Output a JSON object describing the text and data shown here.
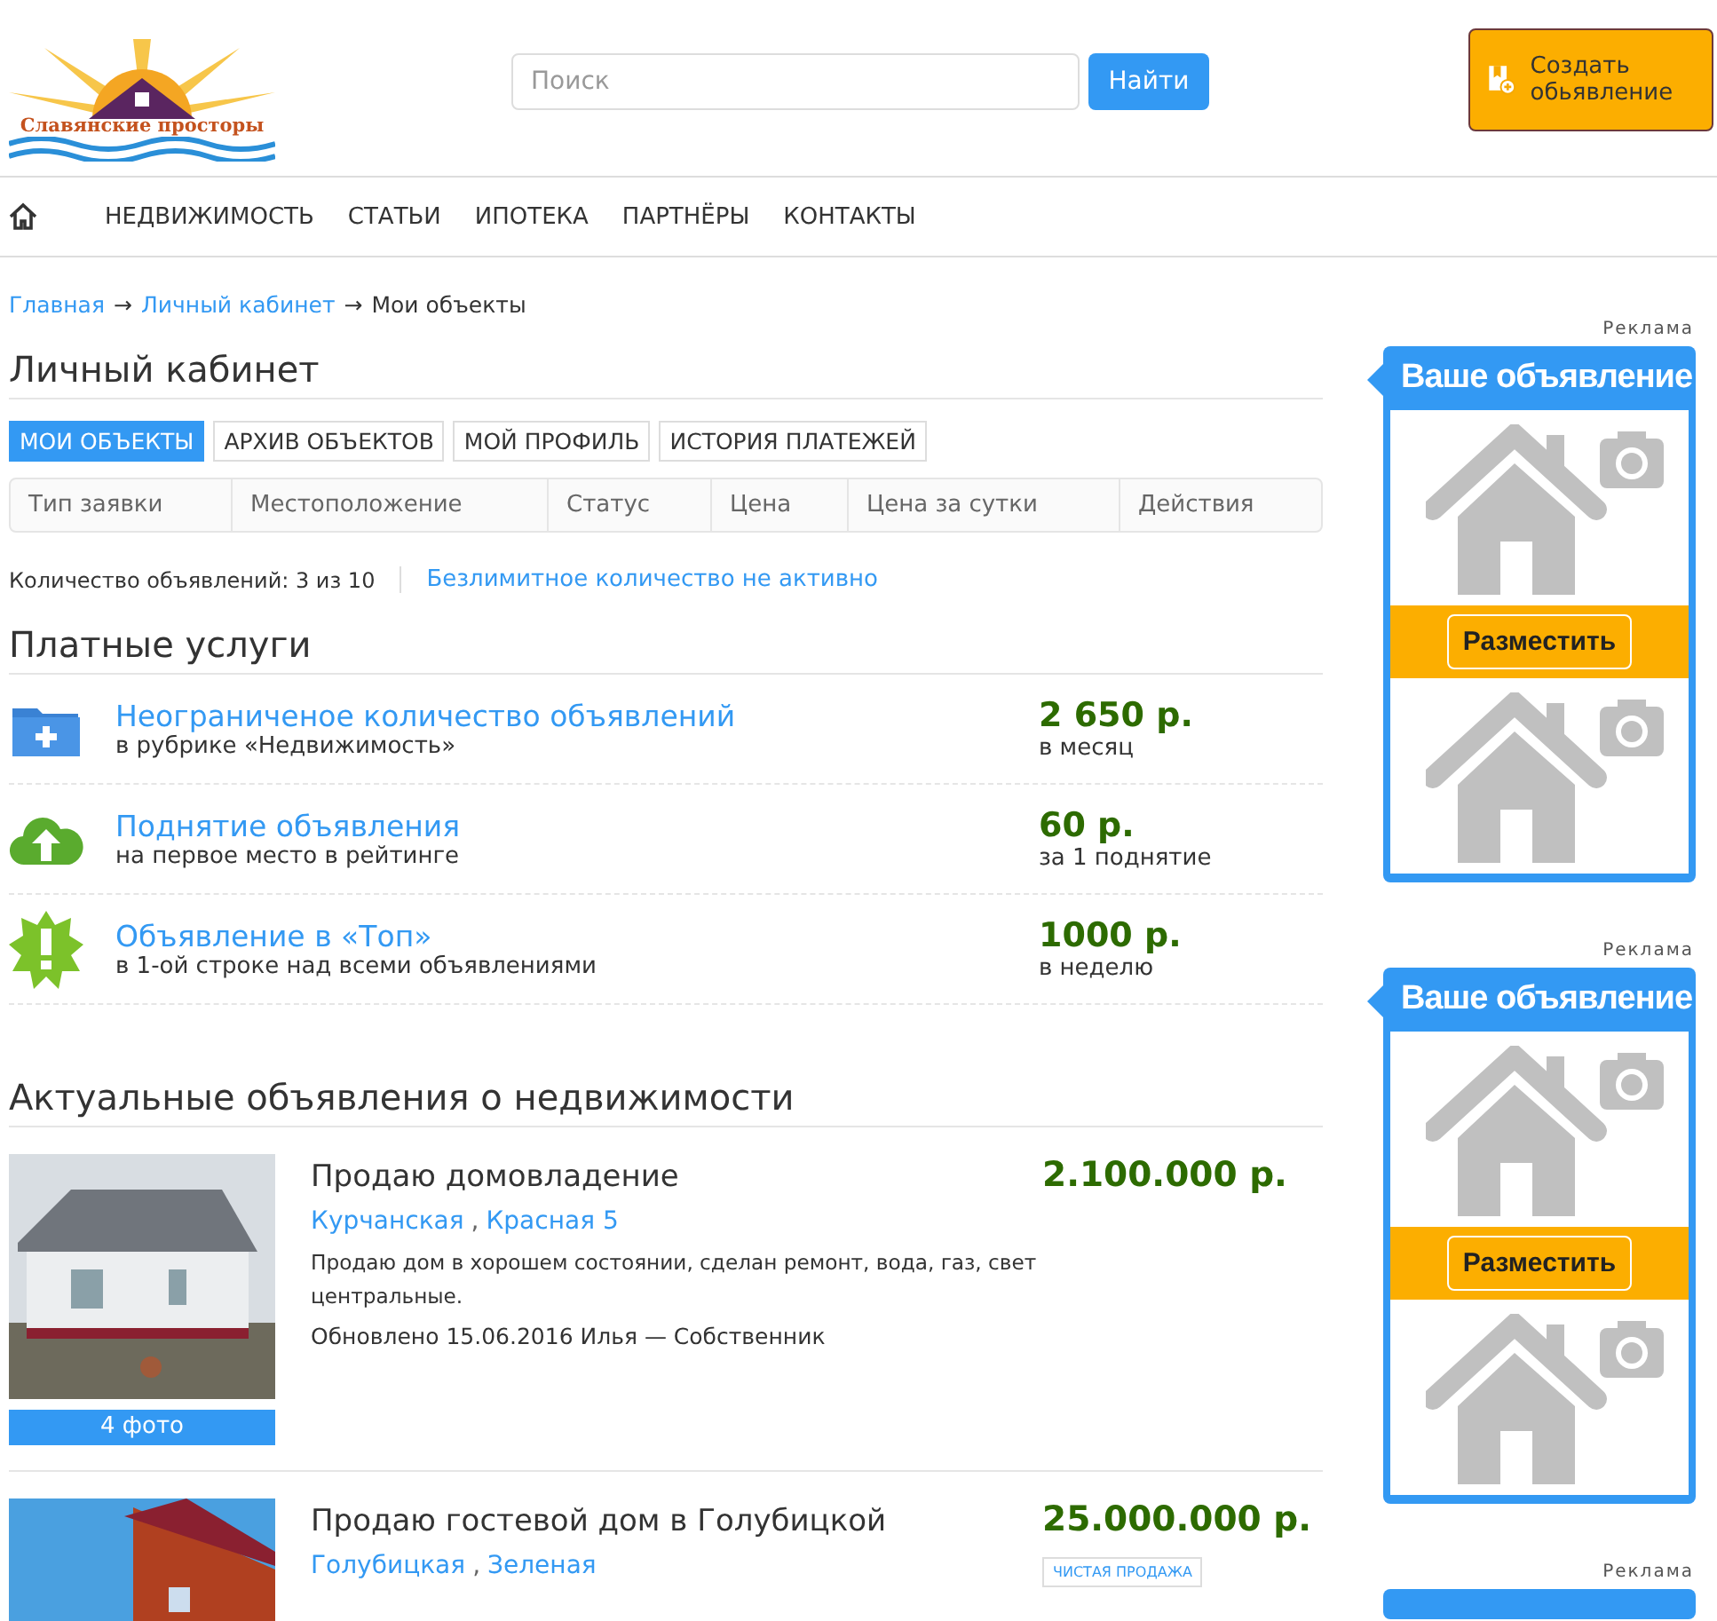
{
  "header": {
    "logo_text": "Славянские просторы",
    "search": {
      "placeholder": "Поиск",
      "button": "Найти"
    },
    "create_button": "Создать обьявление"
  },
  "nav": {
    "items": [
      "НЕДВИЖИМОСТЬ",
      "СТАТЬИ",
      "ИПОТЕКА",
      "ПАРТНЁРЫ",
      "КОНТАКТЫ"
    ]
  },
  "breadcrumbs": {
    "links": [
      "Главная",
      "Личный кабинет"
    ],
    "separator": "→",
    "current": "Мои объекты"
  },
  "cabinet": {
    "title": "Личный кабинет",
    "tabs": [
      {
        "label": "МОИ ОБЪЕКТЫ",
        "selected": true
      },
      {
        "label": "АРХИВ ОБЪЕКТОВ",
        "selected": false
      },
      {
        "label": "МОЙ ПРОФИЛЬ",
        "selected": false
      },
      {
        "label": "ИСТОРИЯ ПЛАТЕЖЕЙ",
        "selected": false
      }
    ],
    "table": {
      "columns": [
        "Тип заявки",
        "Местоположение",
        "Статус",
        "Цена",
        "Цена за сутки",
        "Действия"
      ]
    },
    "count": "Количество объявлений: 3 из 10",
    "unlimited_link": "Безлимитное количество не активно"
  },
  "paid_services": {
    "title": "Платные услуги",
    "items": [
      {
        "kind": "folder",
        "title": "Неограниченое количество объявлений",
        "subtitle": "в рубрике «Недвижимость»",
        "price": "2 650 р.",
        "period": "в месяц"
      },
      {
        "kind": "cloud",
        "title": "Поднятие объявления",
        "subtitle": "на первое место в рейтинге",
        "price": "60 р.",
        "period": "за 1 поднятие"
      },
      {
        "kind": "burst",
        "title": "Объявление в «Топ»",
        "subtitle": "в 1-ой строке над всеми объявлениями",
        "price": "1000 р.",
        "period": "в неделю"
      }
    ]
  },
  "listings": {
    "title": "Актуальные объявления о недвижимости",
    "location_separator": ",",
    "items": [
      {
        "title": "Продаю домовладение",
        "location": [
          "Курчанская",
          "Красная 5"
        ],
        "description": "Продаю дом в хорошем состоянии, сделан ремонт, вода, газ, свет центральные.",
        "meta": "Обновлено 15.06.2016 Илья — Собственник",
        "price": "2.100.000 р.",
        "photos": "4 фото"
      },
      {
        "title": "Продаю гостевой дом в Голубицкой",
        "location": [
          "Голубицкая",
          "Зеленая"
        ],
        "price": "25.000.000 р.",
        "tag": "ЧИСТАЯ ПРОДАЖА"
      }
    ]
  },
  "ads": [
    {
      "label": "Реклама",
      "title": "Ваше объявление",
      "button": "Разместить"
    },
    {
      "label": "Реклама",
      "title": "Ваше объявление",
      "button": "Разместить"
    },
    {
      "label": "Реклама"
    }
  ]
}
